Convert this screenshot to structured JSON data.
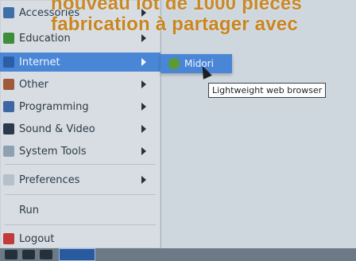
{
  "overlay": {
    "line1": "nouveau lot de 1000 pièces",
    "line2": "fabrication à partager avec"
  },
  "menu": {
    "items": [
      {
        "label": "Accessories",
        "icon": "accessories-icon",
        "has_submenu": true,
        "selected": false
      },
      {
        "label": "Education",
        "icon": "education-icon",
        "has_submenu": true,
        "selected": false
      },
      {
        "label": "Internet",
        "icon": "internet-icon",
        "has_submenu": true,
        "selected": true
      },
      {
        "label": "Other",
        "icon": "other-icon",
        "has_submenu": true,
        "selected": false
      },
      {
        "label": "Programming",
        "icon": "programming-icon",
        "has_submenu": true,
        "selected": false
      },
      {
        "label": "Sound & Video",
        "icon": "sound-video-icon",
        "has_submenu": true,
        "selected": false
      },
      {
        "label": "System Tools",
        "icon": "system-tools-icon",
        "has_submenu": true,
        "selected": false
      },
      {
        "label": "Preferences",
        "icon": "preferences-icon",
        "has_submenu": true,
        "selected": false
      },
      {
        "label": "Run",
        "icon": "",
        "has_submenu": false,
        "selected": false
      },
      {
        "label": "Logout",
        "icon": "logout-icon",
        "has_submenu": false,
        "selected": false
      }
    ]
  },
  "submenu": {
    "item_label": "Midori",
    "tooltip": "Lightweight web browser"
  },
  "colors": {
    "menu_bg": "#d7dde3",
    "selection": "#4a86d6",
    "overlay_text": "#c98520"
  }
}
